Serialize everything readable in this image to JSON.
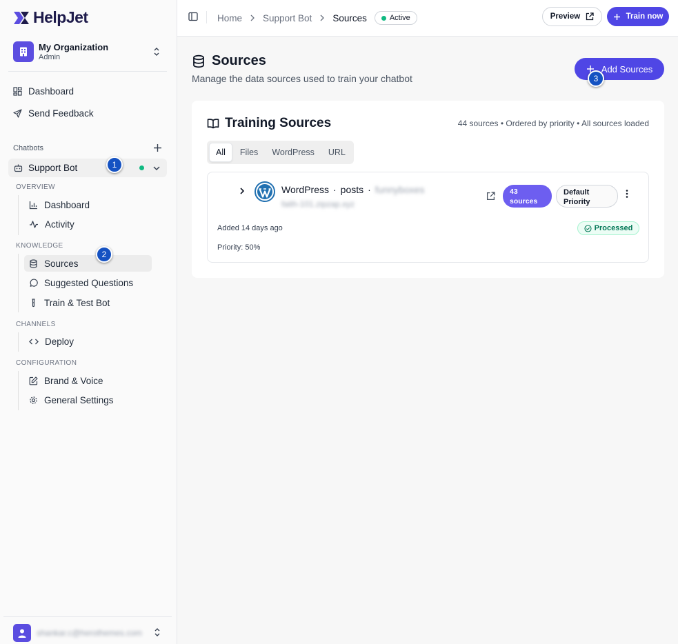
{
  "app": {
    "name": "HelpJet"
  },
  "organization": {
    "name": "My Organization",
    "role": "Admin"
  },
  "sidebar": {
    "top_items": [
      {
        "label": "Dashboard",
        "icon": "grid-icon"
      },
      {
        "label": "Send Feedback",
        "icon": "send-icon"
      }
    ],
    "chatbots_label": "Chatbots",
    "bot": {
      "name": "Support Bot",
      "status_color": "#10b981"
    },
    "sections": [
      {
        "label": "OVERVIEW",
        "items": [
          {
            "label": "Dashboard",
            "icon": "bar-chart-icon"
          },
          {
            "label": "Activity",
            "icon": "activity-icon"
          }
        ]
      },
      {
        "label": "KNOWLEDGE",
        "items": [
          {
            "label": "Sources",
            "icon": "database-icon",
            "active": true
          },
          {
            "label": "Suggested Questions",
            "icon": "message-circle-icon"
          },
          {
            "label": "Train & Test Bot",
            "icon": "test-tube-icon"
          }
        ]
      },
      {
        "label": "CHANNELS",
        "items": [
          {
            "label": "Deploy",
            "icon": "code-icon"
          }
        ]
      },
      {
        "label": "CONFIGURATION",
        "items": [
          {
            "label": "Brand & Voice",
            "icon": "edit-icon"
          },
          {
            "label": "General Settings",
            "icon": "gear-icon"
          }
        ]
      }
    ],
    "user": {
      "email": "shankar.c@herothemes.com"
    }
  },
  "markers": [
    "1",
    "2",
    "3"
  ],
  "topbar": {
    "breadcrumbs": [
      "Home",
      "Support Bot",
      "Sources"
    ],
    "status": "Active",
    "preview_label": "Preview",
    "train_label": "Train now"
  },
  "page": {
    "title": "Sources",
    "subtitle": "Manage the data sources used to train your chatbot",
    "add_label": "Add Sources"
  },
  "training": {
    "title": "Training Sources",
    "meta": "44 sources • Ordered by priority • All sources loaded",
    "tabs": [
      "All",
      "Files",
      "WordPress",
      "URL"
    ],
    "active_tab": "All",
    "source": {
      "type": "WordPress",
      "kind": "posts",
      "site": "funnyboxes",
      "url": "faith-101.zipzap.xyz",
      "count_line1": "43",
      "count_line2": "sources",
      "priority_line1": "Default",
      "priority_line2": "Priority",
      "added": "Added 14 days ago",
      "priority": "Priority: 50%",
      "status": "Processed"
    }
  },
  "colors": {
    "accent": "#4f46e5",
    "success": "#10b981"
  }
}
